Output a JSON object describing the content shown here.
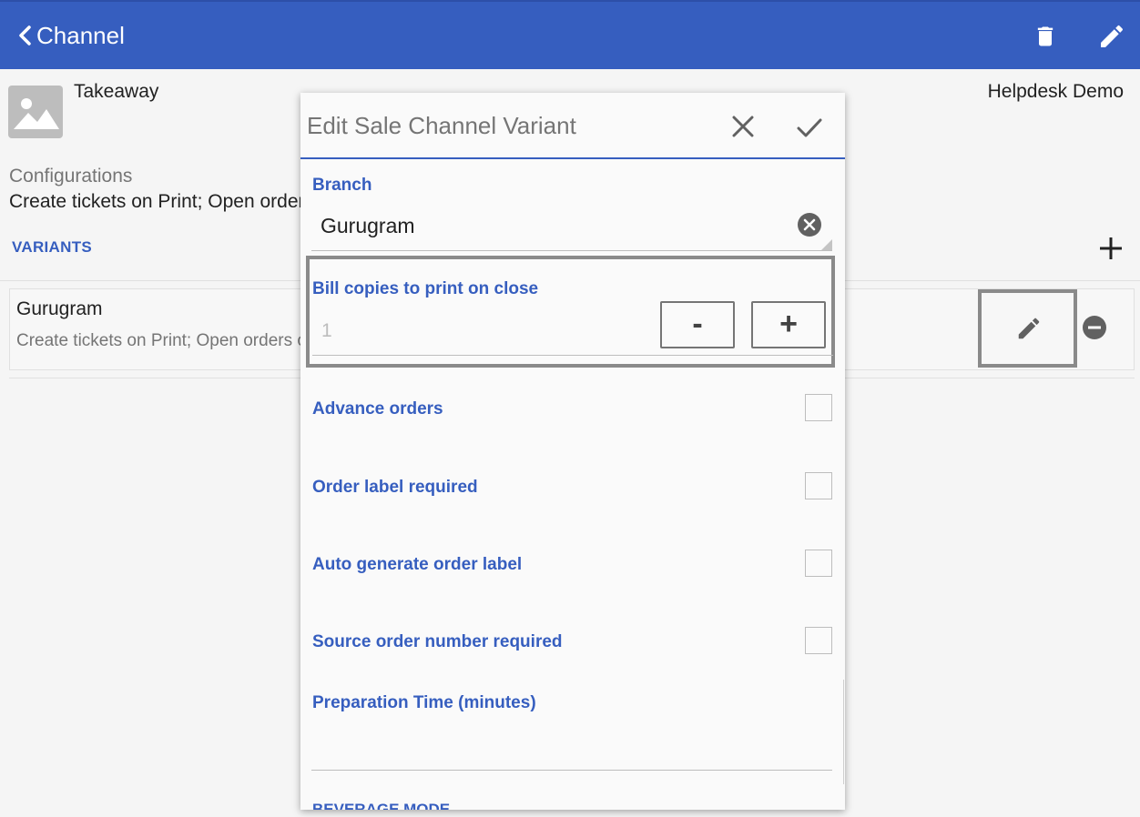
{
  "appbar": {
    "title": "Channel",
    "accent_color": "#365ebf",
    "icons": [
      "chevron-left-icon",
      "trash-icon",
      "pencil-icon"
    ]
  },
  "channel": {
    "name": "Takeaway",
    "company": "Helpdesk Demo",
    "configurations_label": "Configurations",
    "configurations_value": "Create tickets on Print; Open orders on Print"
  },
  "variants": {
    "heading": "VARIANTS",
    "items": [
      {
        "name": "Gurugram",
        "description": "Create tickets on Print; Open orders on Print"
      }
    ]
  },
  "dialog": {
    "title": "Edit Sale Channel Variant",
    "branch": {
      "label": "Branch",
      "value": "Gurugram"
    },
    "bill_copies": {
      "label": "Bill copies to print on close",
      "value": "1",
      "minus_label": "-",
      "plus_label": "+"
    },
    "checkboxes": [
      {
        "label": "Advance orders",
        "checked": false
      },
      {
        "label": "Order label required",
        "checked": false
      },
      {
        "label": "Auto generate order label",
        "checked": false
      },
      {
        "label": "Source order number required",
        "checked": false
      }
    ],
    "preparation_time": {
      "label": "Preparation Time (minutes)",
      "value": ""
    },
    "next_section_label": "BEVERAGE MODE"
  }
}
